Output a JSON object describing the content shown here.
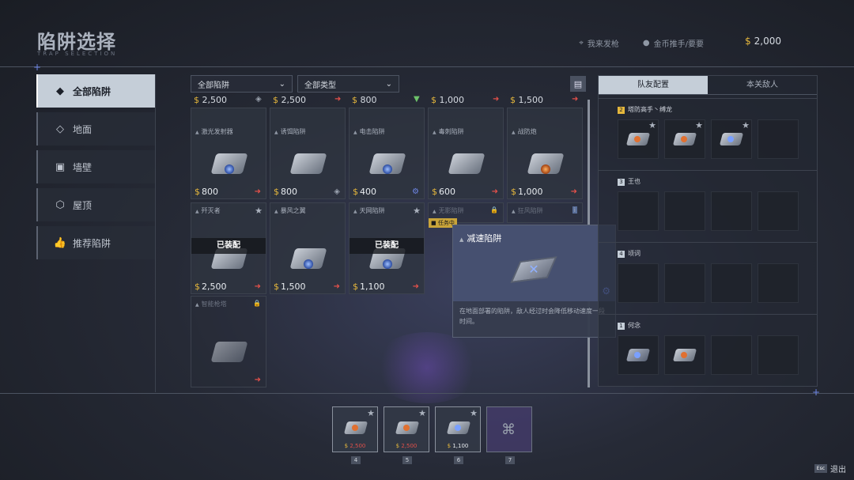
{
  "header": {
    "title": "陷阱选择",
    "subtitle": "TRAP SELECTION",
    "actions": [
      {
        "icon": "gun-icon",
        "label": "我来发枪"
      },
      {
        "icon": "user-icon",
        "label": "金币推手/要要"
      }
    ],
    "money": "2,000",
    "currency_symbol": "$"
  },
  "sidebar": {
    "items": [
      {
        "label": "全部陷阱",
        "icon": "cube-icon",
        "active": true
      },
      {
        "label": "地面",
        "icon": "floor-icon",
        "active": false
      },
      {
        "label": "墙壁",
        "icon": "wall-icon",
        "active": false
      },
      {
        "label": "屋顶",
        "icon": "roof-icon",
        "active": false
      },
      {
        "label": "推荐陷阱",
        "icon": "thumbs-up-icon",
        "active": false
      }
    ]
  },
  "filters": {
    "trap_filter": "全部陷阱",
    "type_filter": "全部类型"
  },
  "row0_prices": [
    "2,500",
    "2,500",
    "800",
    "1,000",
    "1,500"
  ],
  "cards": [
    {
      "name": "激光发射器",
      "bottom_price": "800"
    },
    {
      "name": "诱饵陷阱",
      "bottom_price": "800"
    },
    {
      "name": "电击陷阱",
      "bottom_price": "400"
    },
    {
      "name": "毒刺陷阱",
      "bottom_price": "600"
    },
    {
      "name": "战防炮",
      "bottom_price": "1,000"
    },
    {
      "name": "歼灭者",
      "bottom_price": "2,500",
      "equipped": "已装配"
    },
    {
      "name": "暴风之翼",
      "bottom_price": "1,500"
    },
    {
      "name": "天网陷阱",
      "bottom_price": "1,100",
      "equipped": "已装配"
    },
    {
      "name": "无影陷阱"
    },
    {
      "name": "狂风陷阱"
    },
    {
      "name": "智能枪塔"
    }
  ],
  "quest_tag": "任务中",
  "tooltip": {
    "name": "减速陷阱",
    "description": "在地面部署的陷阱，敌人经过时会降低移动速度一段时间。"
  },
  "right_panel": {
    "tabs": [
      "队友配置",
      "本关敌人"
    ],
    "teams": [
      {
        "num": "2",
        "name": "塔防高手丶缚龙"
      },
      {
        "num": "3",
        "name": "王也"
      },
      {
        "num": "4",
        "name": "顷词"
      },
      {
        "num": "1",
        "name": "何念"
      }
    ]
  },
  "bottom_slots": [
    {
      "cost": "2,500",
      "num": "4"
    },
    {
      "cost": "2,500",
      "num": "5"
    },
    {
      "cost": "1,100",
      "num": "6"
    },
    {
      "cost": "",
      "num": "7"
    }
  ],
  "exit": {
    "key": "Esc",
    "label": "退出"
  }
}
